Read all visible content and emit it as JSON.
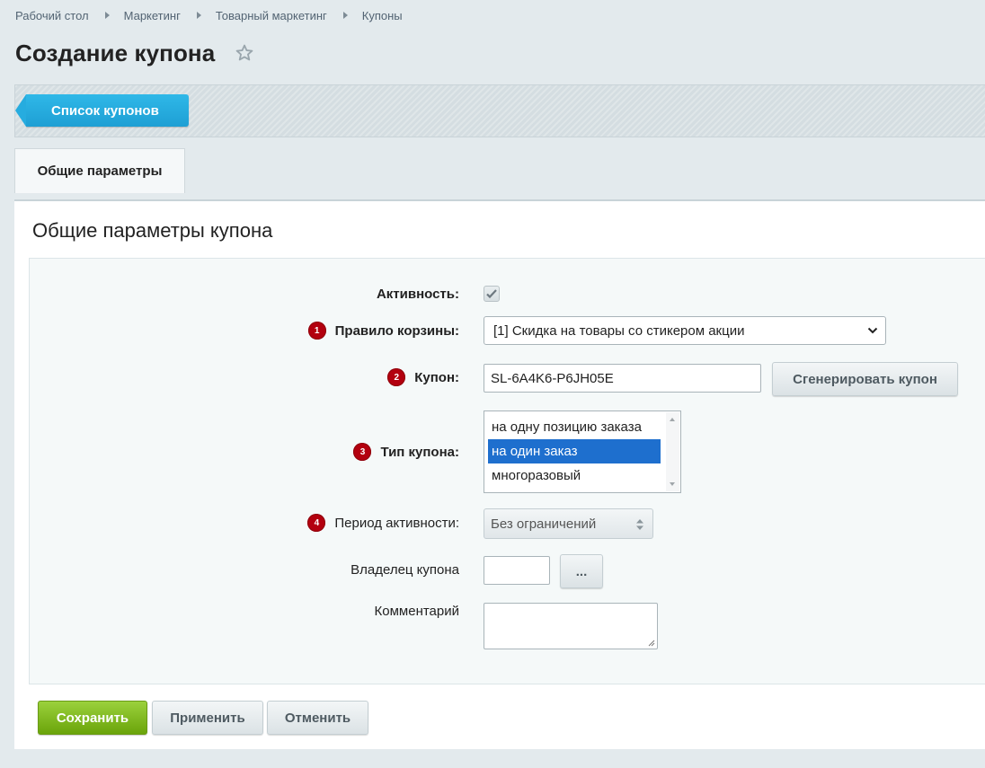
{
  "breadcrumb": [
    "Рабочий стол",
    "Маркетинг",
    "Товарный маркетинг",
    "Купоны"
  ],
  "page_title": "Создание купона",
  "toolbar": {
    "back_label": "Список купонов"
  },
  "tabs": [
    {
      "label": "Общие параметры"
    }
  ],
  "section_title": "Общие параметры купона",
  "form": {
    "active": {
      "label": "Активность:",
      "checked": true
    },
    "basket_rule": {
      "badge": "1",
      "label": "Правило корзины:",
      "value": "[1] Скидка на товары со стикером акции"
    },
    "coupon": {
      "badge": "2",
      "label": "Купон:",
      "value": "SL-6A4K6-P6JH05E",
      "generate_label": "Сгенерировать купон"
    },
    "coupon_type": {
      "badge": "3",
      "label": "Тип купона:",
      "options": [
        "на одну позицию заказа",
        "на один заказ",
        "многоразовый"
      ],
      "selected": "на один заказ"
    },
    "period": {
      "badge": "4",
      "label": "Период активности:",
      "value": "Без ограничений"
    },
    "owner": {
      "label": "Владелец купона",
      "value": "",
      "browse_label": "..."
    },
    "comment": {
      "label": "Комментарий",
      "value": ""
    }
  },
  "buttons": {
    "save": "Сохранить",
    "apply": "Применить",
    "cancel": "Отменить"
  },
  "colors": {
    "accent_blue": "#1e9fd4",
    "save_green": "#6aa40a",
    "badge_red": "#b3000f",
    "selection_blue": "#1e6fce"
  }
}
